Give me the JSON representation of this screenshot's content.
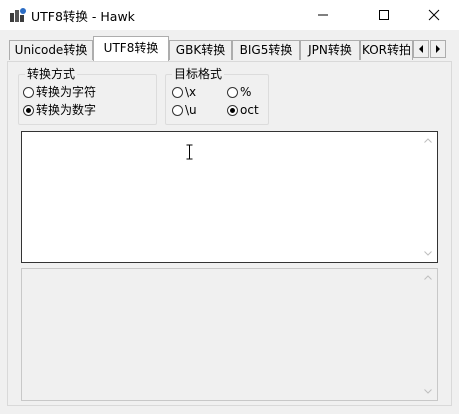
{
  "window": {
    "title": "UTF8转换 - Hawk",
    "icon": "hawk-app-icon",
    "controls": [
      "minimize-icon",
      "maximize-icon",
      "close-icon"
    ]
  },
  "tabs": [
    {
      "label": "Unicode转换",
      "active": false
    },
    {
      "label": "UTF8转换",
      "active": true
    },
    {
      "label": "GBK转换",
      "active": false
    },
    {
      "label": "BIG5转换",
      "active": false
    },
    {
      "label": "JPN转换",
      "active": false
    },
    {
      "label": "KOR转拍",
      "active": false
    }
  ],
  "tab_scroll": {
    "left": "chevron-left-icon",
    "right": "chevron-right-icon"
  },
  "conversion_mode": {
    "title": "转换方式",
    "options": [
      {
        "label": "转换为字符",
        "checked": false
      },
      {
        "label": "转换为数字",
        "checked": true
      }
    ]
  },
  "target_format": {
    "title": "目标格式",
    "options": [
      {
        "label": "\\x",
        "checked": false
      },
      {
        "label": "%",
        "checked": false
      },
      {
        "label": "\\u",
        "checked": false
      },
      {
        "label": "oct",
        "checked": true
      }
    ]
  },
  "input_text": {
    "value": ""
  },
  "output_text": {
    "value": ""
  },
  "colors": {
    "border_active": "#333333",
    "panel_bg": "#f0f0f0",
    "field_bg": "#ffffff"
  }
}
